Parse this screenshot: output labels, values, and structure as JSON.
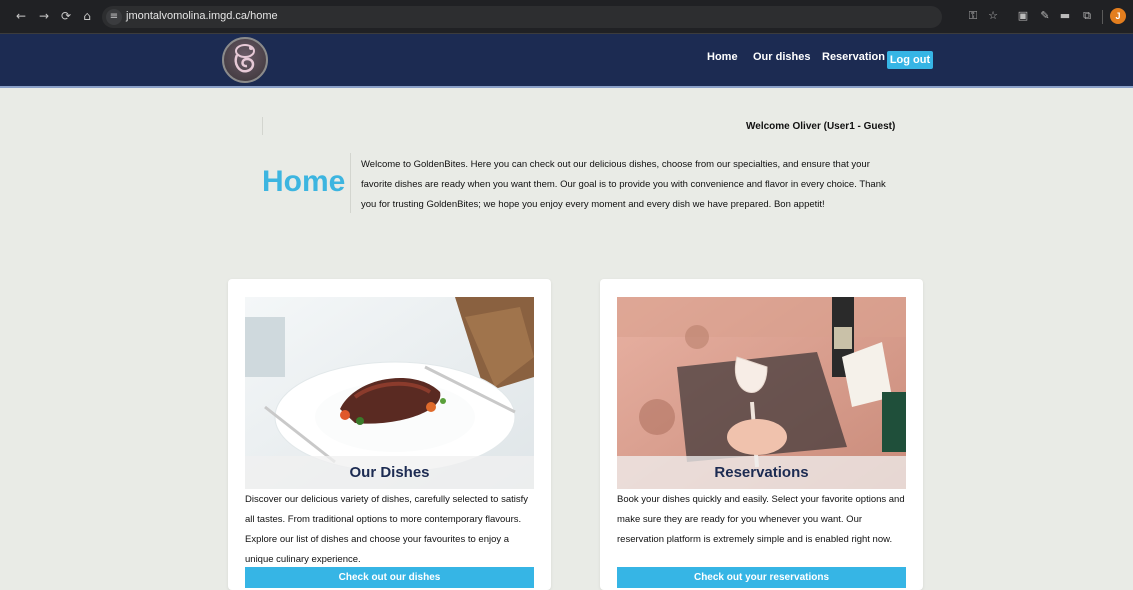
{
  "browser": {
    "url": "jmontalvomolina.imgd.ca/home",
    "nav_icons": [
      "back-arrow-icon",
      "forward-arrow-icon",
      "reload-icon",
      "home-icon"
    ],
    "ext_icons": [
      "key-icon",
      "star-icon",
      "translate-icon",
      "pen-icon",
      "extension-icon",
      "puzzle-icon"
    ],
    "profile_initial": "J"
  },
  "header": {
    "logo": "chef-logo",
    "nav": {
      "home": "Home",
      "dishes": "Our dishes",
      "reservation": "Reservation",
      "logout": "Log out"
    },
    "colors": {
      "background": "#1c2b52",
      "accent": "#36b5e5"
    }
  },
  "main": {
    "welcome": "Welcome Oliver (User1 - Guest)",
    "title": "Home",
    "intro": "Welcome to GoldenBites. Here you can check out our delicious dishes, choose from our specialties, and ensure that your favorite dishes are ready when you want them. Our goal is to provide you with convenience and flavor in every choice. Thank you for trusting GoldenBites; we hope you enjoy every moment and every dish we have prepared. Bon appetit!",
    "cards": [
      {
        "caption": "Our Dishes",
        "description": "Discover our delicious variety of dishes, carefully selected to satisfy all tastes. From traditional options to more contemporary flavours. Explore our list of dishes and choose your favourites to enjoy a unique culinary experience.",
        "button": "Check out our dishes"
      },
      {
        "caption": "Reservations",
        "description": "Book your dishes quickly and easily. Select your favorite options and make sure they are ready for you whenever you want. Our reservation platform is extremely simple and is enabled right now.",
        "button": "Check out your reservations"
      }
    ]
  }
}
